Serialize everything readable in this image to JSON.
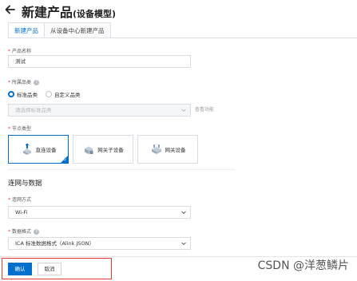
{
  "header": {
    "title": "新建产品",
    "subtitle": "(设备模型)"
  },
  "tabs": [
    {
      "label": "新建产品",
      "active": true
    },
    {
      "label": "从设备中心新建产品",
      "active": false
    }
  ],
  "form": {
    "product_name": {
      "label": "产品名称",
      "value": "测试"
    },
    "category": {
      "label": "所属品类",
      "options": [
        {
          "label": "标准品类",
          "selected": true
        },
        {
          "label": "自定义品类",
          "selected": false
        }
      ],
      "select_placeholder": "请选择标准品类",
      "view_link": "查看功能"
    },
    "node_type": {
      "label": "节点类型",
      "options": [
        {
          "label": "直连设备",
          "selected": true
        },
        {
          "label": "网关子设备",
          "selected": false
        },
        {
          "label": "网关设备",
          "selected": false
        }
      ]
    },
    "section_title": "连网与数据",
    "network": {
      "label": "连网方式",
      "value": "Wi-Fi"
    },
    "data_format": {
      "label": "数据格式",
      "value": "ICA 标准数据格式（Alink JSON）"
    }
  },
  "footer": {
    "confirm_label": "确认",
    "cancel_label": "取消"
  },
  "watermark": "CSDN @洋葱鳞片",
  "colors": {
    "accent": "#0070cc",
    "required": "#f23c3c",
    "highlight_border": "#e23b3b"
  }
}
